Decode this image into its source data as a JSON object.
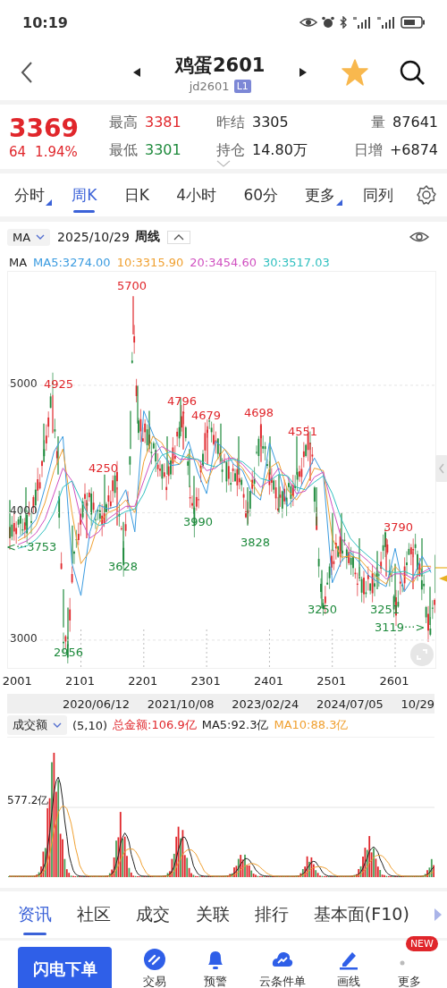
{
  "status_bar": {
    "time": "10:19"
  },
  "header": {
    "title": "鸡蛋2601",
    "code": "jd2601",
    "badge": "L1",
    "favorite": true
  },
  "quote": {
    "price": "3369",
    "change": "64",
    "change_pct": "1.94%",
    "color": "#e0262b",
    "stats": [
      {
        "label": "最高",
        "value": "3381",
        "color": "#e0262b"
      },
      {
        "label": "昨结",
        "value": "3305",
        "color": "#222222"
      },
      {
        "label": "量",
        "value": "87641",
        "color": "#222222"
      },
      {
        "label": "最低",
        "value": "3301",
        "color": "#1e8a3c"
      },
      {
        "label": "持仓",
        "value": "14.80万",
        "color": "#222222"
      },
      {
        "label": "日增",
        "value": "+6874",
        "color": "#222222"
      }
    ]
  },
  "period_tabs": [
    {
      "label": "分时",
      "selected": false,
      "has_menu": true
    },
    {
      "label": "周K",
      "selected": true,
      "has_menu": false
    },
    {
      "label": "日K",
      "selected": false,
      "has_menu": false
    },
    {
      "label": "4小时",
      "selected": false,
      "has_menu": false
    },
    {
      "label": "60分",
      "selected": false,
      "has_menu": false
    },
    {
      "label": "更多",
      "selected": false,
      "has_menu": true
    },
    {
      "label": "同列",
      "selected": false,
      "has_menu": false
    }
  ],
  "chart_toolbar": {
    "indicator": "MA",
    "date": "2025/10/29",
    "period": "周线"
  },
  "ma_legend": {
    "label": "MA",
    "items": [
      {
        "text": "MA5:3274.00",
        "color": "#3a9be0"
      },
      {
        "text": "10:3315.90",
        "color": "#f0a030"
      },
      {
        "text": "20:3454.60",
        "color": "#d050c0"
      },
      {
        "text": "30:3517.03",
        "color": "#30c0c0"
      }
    ]
  },
  "price_chart": {
    "chart_data": {
      "type": "line",
      "grid": true,
      "x": [
        2001,
        2015.3,
        2029.6,
        2043.9,
        2058.1,
        2072.4,
        2086.7,
        2101,
        2115.3,
        2129.6,
        2143.9,
        2158.1,
        2172.4,
        2186.7,
        2201,
        2215.3,
        2229.6,
        2243.9,
        2258.1,
        2272.4,
        2286.7,
        2301,
        2315.3,
        2329.6,
        2343.9,
        2358.1,
        2372.4,
        2386.7,
        2401,
        2415.3,
        2429.6,
        2443.9,
        2458.1,
        2472.4,
        2486.7,
        2501,
        2515.3,
        2529.6,
        2543.9,
        2558.1,
        2572.4,
        2586.7,
        2601,
        2615.3,
        2629.6,
        2643.9,
        2658.1
      ],
      "xlim": [
        1985,
        2665
      ],
      "ylim": [
        2782,
        5891
      ],
      "yticks": [
        3000,
        4000,
        5000
      ],
      "xticks": [
        2001,
        2101,
        2201,
        2301,
        2401,
        2501,
        2601
      ],
      "series": [
        {
          "color": "#3a9be0",
          "values": [
            3800,
            3860,
            3950,
            4200,
            4480,
            4600,
            3600,
            3350,
            3850,
            4060,
            4030,
            4050,
            4180,
            3850,
            4800,
            4620,
            4470,
            4370,
            4380,
            4560,
            4320,
            4150,
            4560,
            4500,
            4380,
            4330,
            4160,
            4100,
            4550,
            4340,
            4050,
            4130,
            4280,
            4430,
            4300,
            3450,
            3620,
            3690,
            3610,
            3510,
            3460,
            3420,
            3720,
            3380,
            3490,
            3660,
            3530
          ]
        },
        {
          "color": "#f0a030",
          "values": [
            3780,
            3820,
            3900,
            4080,
            4330,
            4500,
            4000,
            3600,
            3700,
            3920,
            4000,
            4030,
            4100,
            4000,
            4400,
            4600,
            4550,
            4420,
            4380,
            4460,
            4400,
            4230,
            4400,
            4500,
            4420,
            4350,
            4240,
            4130,
            4350,
            4400,
            4180,
            4100,
            4200,
            4350,
            4330,
            3800,
            3650,
            3660,
            3640,
            3560,
            3490,
            3440,
            3580,
            3500,
            3450,
            3580,
            3580
          ]
        },
        {
          "color": "#d050c0",
          "values": [
            3750,
            3780,
            3840,
            3950,
            4150,
            4350,
            4250,
            3950,
            3800,
            3850,
            3950,
            4000,
            4050,
            4050,
            4250,
            4450,
            4520,
            4480,
            4420,
            4420,
            4420,
            4330,
            4350,
            4420,
            4430,
            4380,
            4300,
            4200,
            4250,
            4350,
            4280,
            4150,
            4170,
            4280,
            4320,
            4050,
            3800,
            3700,
            3680,
            3620,
            3550,
            3480,
            3520,
            3520,
            3480,
            3530,
            3570
          ]
        },
        {
          "color": "#30c0c0",
          "values": [
            3720,
            3740,
            3790,
            3870,
            4000,
            4200,
            4250,
            4100,
            3950,
            3900,
            3920,
            3970,
            4010,
            4030,
            4150,
            4330,
            4450,
            4480,
            4450,
            4430,
            4420,
            4380,
            4360,
            4400,
            4420,
            4400,
            4340,
            4270,
            4250,
            4300,
            4290,
            4200,
            4180,
            4240,
            4290,
            4150,
            3950,
            3800,
            3720,
            3660,
            3600,
            3540,
            3530,
            3540,
            3510,
            3520,
            3550
          ]
        }
      ]
    },
    "price_marks": [
      {
        "text": "5700",
        "color": "#e0262b"
      },
      {
        "text": "4925",
        "color": "#e0262b"
      },
      {
        "text": "4796",
        "color": "#e0262b"
      },
      {
        "text": "4679",
        "color": "#e0262b"
      },
      {
        "text": "4698",
        "color": "#e0262b"
      },
      {
        "text": "4551",
        "color": "#e0262b"
      },
      {
        "text": "4250",
        "color": "#e0262b"
      },
      {
        "text": "3990",
        "color": "#1e8a3c"
      },
      {
        "text": "3790",
        "color": "#e0262b"
      },
      {
        "text": "<···3753",
        "color": "#1e8a3c"
      },
      {
        "text": "3828",
        "color": "#1e8a3c"
      },
      {
        "text": "3628",
        "color": "#1e8a3c"
      },
      {
        "text": "3250",
        "color": "#1e8a3c"
      },
      {
        "text": "3251",
        "color": "#1e8a3c"
      },
      {
        "text": "3119···>",
        "color": "#1e8a3c"
      },
      {
        "text": "2956",
        "color": "#1e8a3c"
      }
    ],
    "date_labels": [
      "2020/06/12",
      "2021/10/08",
      "2023/02/24",
      "2024/07/05",
      "10/29"
    ]
  },
  "volume": {
    "indicator": "成交额",
    "params": "(5,10)",
    "items": [
      {
        "text": "总金额:106.9亿",
        "color": "#e0262b"
      },
      {
        "text": "MA5:92.3亿",
        "color": "#222222"
      },
      {
        "text": "MA10:88.3亿",
        "color": "#f0a030"
      }
    ],
    "y_label": "577.2亿"
  },
  "info_tabs": [
    {
      "label": "资讯",
      "selected": true
    },
    {
      "label": "社区",
      "selected": false
    },
    {
      "label": "成交",
      "selected": false
    },
    {
      "label": "关联",
      "selected": false
    },
    {
      "label": "排行",
      "selected": false
    },
    {
      "label": "基本面(F10)",
      "selected": false
    }
  ],
  "bottom_bar": {
    "primary": "闪电下单",
    "actions": [
      {
        "label": "交易",
        "kind": "trade"
      },
      {
        "label": "预警",
        "kind": "alert"
      },
      {
        "label": "云条件单",
        "kind": "cloud"
      },
      {
        "label": "画线",
        "kind": "draw"
      },
      {
        "label": "更多",
        "kind": "more",
        "badge": "NEW"
      }
    ]
  }
}
